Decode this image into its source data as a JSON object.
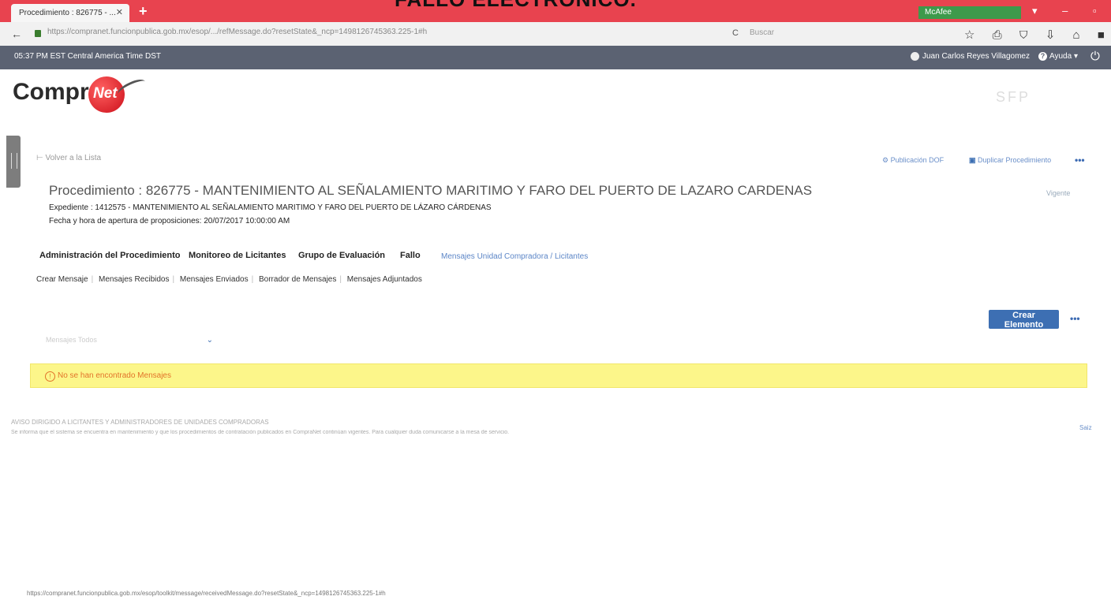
{
  "banner": {
    "text": "FALLO ELECTRÓNICO."
  },
  "browser": {
    "tab_title": "Procedimiento : 826775 - ...",
    "tab_close": "✕",
    "new_tab": "+",
    "url": "https://compranet.funcionpublica.gob.mx/esop/.../refMessage.do?resetState&_ncp=1498126745363.225-1#h",
    "search_placeholder": "Buscar",
    "reload": "C",
    "mcafee": "McAfee",
    "window_controls": "▾ – ▫ ✕",
    "toolbar_icons": "☆ ⎙ ⛉ ⇩ ⌂ ■ ≡"
  },
  "header": {
    "clock": "05:37 PM EST   Central America Time DST",
    "user": "Juan Carlos Reyes Villagomez",
    "help": "Ayuda ▾",
    "help_icon": "?",
    "power_icon": "⏻"
  },
  "logo": {
    "text": "Compra",
    "ball": "Net",
    "sfp": "SFP"
  },
  "nav": {
    "back_link": "⊢ Volver a la Lista",
    "publish_doF": "Publicación DOF",
    "duplicate": "Duplicar Procedimiento",
    "more": "•••"
  },
  "procedure": {
    "title": "Procedimiento : 826775 - MANTENIMIENTO AL SEÑALAMIENTO MARITIMO Y FARO DEL PUERTO DE LAZARO CARDENAS",
    "badge": "Vigente",
    "expediente": "Expediente : 1412575 - MANTENIMIENTO AL SEÑALAMIENTO MARITIMO Y FARO DEL PUERTO DE LÁZARO CÁRDENAS",
    "fecha": "Fecha y hora de apertura de proposiciones: 20/07/2017 10:00:00 AM"
  },
  "tabs": [
    {
      "label": "Administración del Procedimiento"
    },
    {
      "label": "Monitoreo de Licitantes"
    },
    {
      "label": "Grupo de Evaluación"
    },
    {
      "label": "Fallo"
    },
    {
      "label": "Mensajes Unidad Compradora / Licitantes"
    }
  ],
  "subtabs": [
    "Crear Mensaje",
    "Mensajes Recibidos",
    "Mensajes Enviados",
    "Borrador de Mensajes",
    "Mensajes Adjuntados"
  ],
  "actions": {
    "create": "Crear Elemento",
    "more": "•••"
  },
  "filter": {
    "placeholder": "Mensajes Todos",
    "chevron": "⌄"
  },
  "alert": {
    "icon": "!",
    "text": "No se han encontrado Mensajes"
  },
  "footer": {
    "title": "AVISO DIRIGIDO A LICITANTES Y ADMINISTRADORES DE UNIDADES COMPRADORAS",
    "body": "Se informa que el sistema se encuentra en mantenimiento y que los procedimientos de contratación publicados en CompraNet continúan vigentes. Para cualquier duda comunicarse a la mesa de servicio.",
    "link": "Saiz"
  },
  "status_url": "https://compranet.funcionpublica.gob.mx/esop/toolkit/message/receivedMessage.do?resetState&_ncp=1498126745363.225-1#h"
}
